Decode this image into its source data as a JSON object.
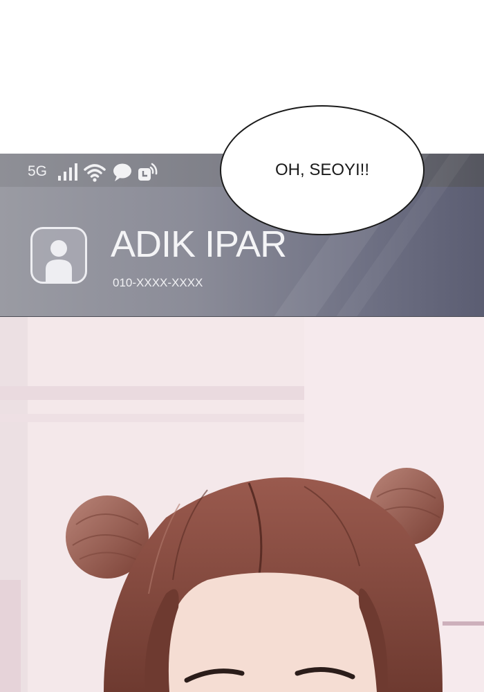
{
  "status_bar": {
    "network": "5G",
    "icons": [
      "signal-icon",
      "wifi-icon",
      "chat-bubble-icon",
      "alarm-icon"
    ]
  },
  "caller": {
    "name": "ADIK IPAR",
    "number": "010-XXXX-XXXX",
    "avatar_icon": "person-silhouette-icon"
  },
  "speech_bubble": {
    "text": "OH, SEOYI!!"
  },
  "colors": {
    "panel_dark": "#5b5d72",
    "panel_light": "#9a9ba3",
    "hair": "#7a4035",
    "skin": "#f3dcd2",
    "background_wall": "#f3e6e8"
  }
}
